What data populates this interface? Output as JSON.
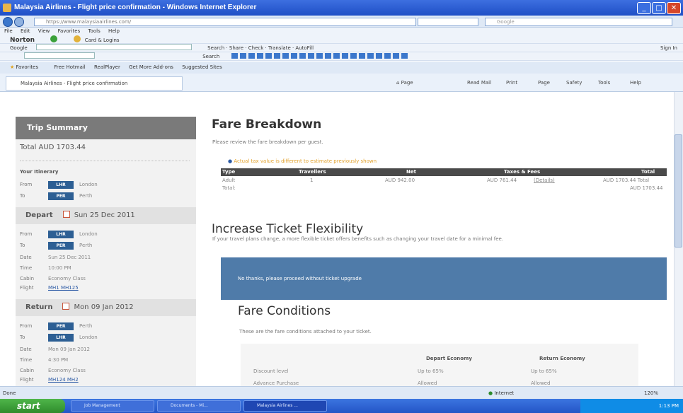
{
  "window": {
    "title": "Malaysia Airlines - Flight price confirmation - Windows Internet Explorer"
  },
  "address": {
    "url": "https://www.malaysiaairlines.com/",
    "search_placeholder": "Google"
  },
  "menu": [
    "File",
    "Edit",
    "View",
    "Favorites",
    "Tools",
    "Help"
  ],
  "toolbars": {
    "norton": "Norton",
    "norton_item": "Card & Logins",
    "google": "Google",
    "google_items": "Search · Share · Check · Translate · AutoFill",
    "sign_in": "Sign In",
    "row4": "Search"
  },
  "favorites": {
    "label": "Favorites",
    "items": [
      "Free Hotmail",
      "RealPlayer",
      "Get More Add-ons",
      "Suggested Sites"
    ]
  },
  "tab": {
    "label": "Malaysia Airlines - Flight price confirmation"
  },
  "command_bar": [
    "Page",
    "Read Mail",
    "Print",
    "Page",
    "Safety",
    "Tools",
    "Help"
  ],
  "sidebar": {
    "title": "Trip Summary",
    "total": "Total AUD 1703.44",
    "itinerary_label": "Your Itinerary",
    "from_label": "From",
    "to_label": "To",
    "itinerary": {
      "from_code": "LHR",
      "from_city": "London",
      "to_code": "PER",
      "to_city": "Perth"
    },
    "depart": {
      "title": "Depart",
      "date": "Sun 25 Dec 2011",
      "from_code": "LHR",
      "from_city": "London",
      "to_code": "PER",
      "to_city": "Perth",
      "date_label": "Date",
      "date_value": "Sun 25 Dec 2011",
      "time_label": "Time",
      "time_value": "10:00 PM",
      "cabin_label": "Cabin",
      "cabin_value": "Economy Class",
      "flight_label": "Flight",
      "flight_value": "MH1 MH125"
    },
    "return": {
      "title": "Return",
      "date": "Mon 09 Jan 2012",
      "from_code": "PER",
      "from_city": "Perth",
      "to_code": "LHR",
      "to_city": "London",
      "date_label": "Date",
      "date_value": "Mon 09 Jan 2012",
      "time_label": "Time",
      "time_value": "4:30 PM",
      "cabin_label": "Cabin",
      "cabin_value": "Economy Class",
      "flight_label": "Flight",
      "flight_value": "MH124 MH2"
    }
  },
  "fare": {
    "title": "Fare Breakdown",
    "subtitle": "Please review the fare breakdown per guest.",
    "warning": "Actual tax value is different to estimate previously shown",
    "headers": [
      "Type",
      "Travellers",
      "Net",
      "Taxes & Fees",
      "Total"
    ],
    "row": {
      "type": "Adult",
      "travellers": "1",
      "net": "AUD 942.00",
      "taxes": "AUD 761.44",
      "details": "(Details)",
      "total": "AUD 1703.44 Total"
    },
    "total_label": "Total:",
    "total_value": "AUD 1703.44"
  },
  "flex": {
    "title": "Increase Ticket Flexibility",
    "text": "If your travel plans change, a more flexible ticket offers benefits such as changing your travel date for a minimal fee.",
    "button": "No thanks, please proceed without ticket upgrade"
  },
  "conditions": {
    "title": "Fare Conditions",
    "subtitle": "These are the fare conditions attached to your ticket.",
    "headers": [
      "Depart Economy",
      "Return Economy"
    ],
    "rows": [
      {
        "label": "Discount level",
        "depart": "Up to 65%",
        "return": "Up to 65%"
      },
      {
        "label": "Advance Purchase",
        "depart": "Allowed",
        "return": "Allowed"
      }
    ]
  },
  "status": {
    "left": "Done",
    "zone": "Internet",
    "zoom": "120%"
  },
  "taskbar": {
    "start": "start",
    "items": [
      "Job Management",
      "Documents - Mi...",
      "Malaysia Airlines ..."
    ],
    "clock": "1:13 PM"
  }
}
